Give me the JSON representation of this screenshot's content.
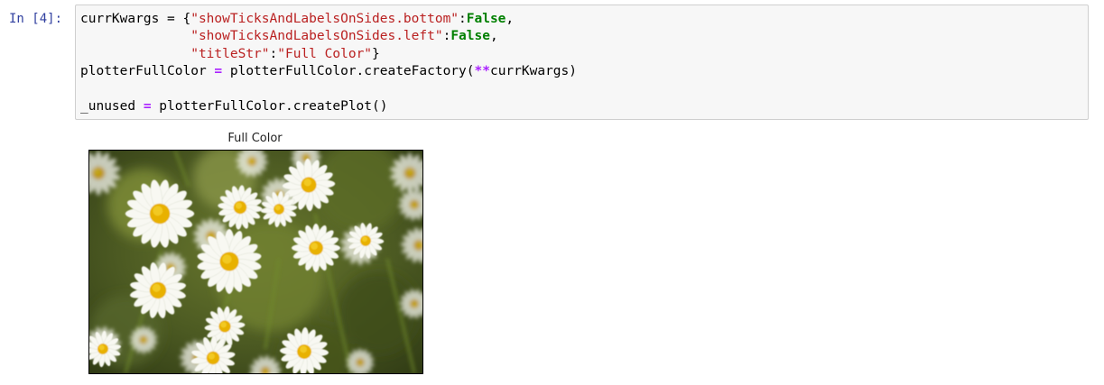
{
  "cell": {
    "prompt": "In [4]:",
    "code": {
      "line1_a": "currKwargs = {",
      "line1_str": "\"showTicksAndLabelsOnSides.bottom\"",
      "line1_colon": ":",
      "line1_kw": "False",
      "line1_end": ",",
      "line2_indent": "              ",
      "line2_str": "\"showTicksAndLabelsOnSides.left\"",
      "line2_colon": ":",
      "line2_kw": "False",
      "line2_end": ",",
      "line3_indent": "              ",
      "line3_key": "\"titleStr\"",
      "line3_colon": ":",
      "line3_val": "\"Full Color\"",
      "line3_end": "}",
      "line4_a": "plotterFullColor ",
      "line4_eq": "=",
      "line4_b": " plotterFullColor.createFactory(",
      "line4_op": "**",
      "line4_c": "currKwargs)",
      "line6_a": "_unused ",
      "line6_eq": "=",
      "line6_b": " plotterFullColor.createPlot()"
    }
  },
  "output": {
    "figure_title": "Full Color",
    "image_subject": "white chamomile daisies with yellow centers on a blurred green background"
  },
  "colors": {
    "prompt": "#303f9f",
    "string": "#ba2121",
    "keyword": "#008000",
    "operator": "#aa22ff"
  }
}
